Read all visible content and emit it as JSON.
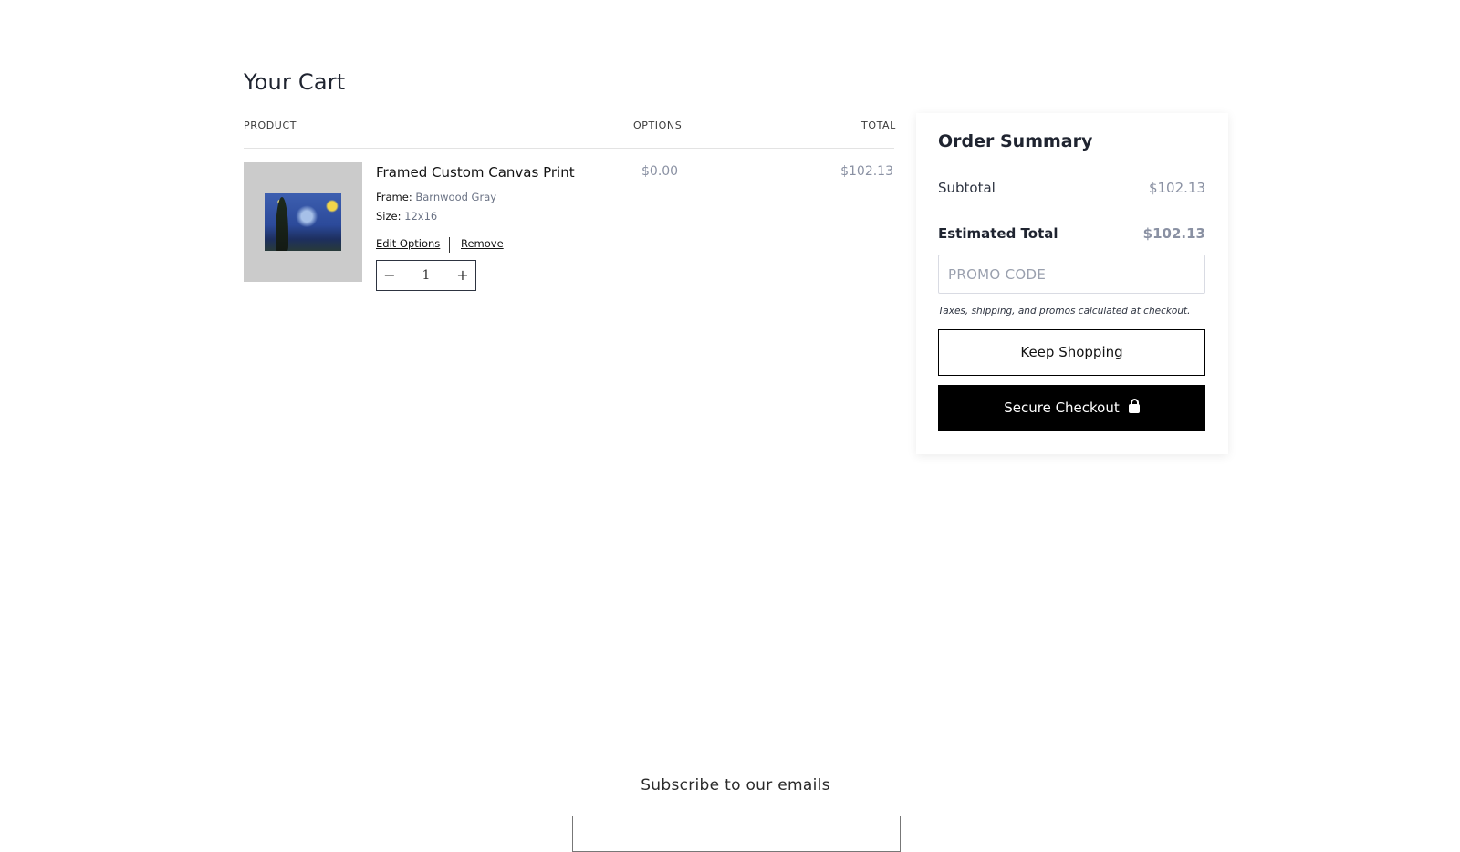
{
  "page": {
    "title": "Your Cart"
  },
  "table": {
    "headers": {
      "product": "PRODUCT",
      "options": "OPTIONS",
      "total": "TOTAL"
    }
  },
  "cart": {
    "items": [
      {
        "name": "Framed Custom Canvas Print",
        "image_alt": "The Starry Night thumbnail",
        "options": [
          {
            "label": "Frame:",
            "value": "Barnwood Gray"
          },
          {
            "label": "Size:",
            "value": "12x16"
          }
        ],
        "edit_label": "Edit Options",
        "remove_label": "Remove",
        "quantity": "1",
        "decrement_symbol": "−",
        "increment_symbol": "+",
        "options_price": "$0.00",
        "total": "$102.13"
      }
    ]
  },
  "summary": {
    "title": "Order Summary",
    "subtotal_label": "Subtotal",
    "subtotal_value": "$102.13",
    "estimated_label": "Estimated Total",
    "estimated_value": "$102.13",
    "promo_placeholder": "PROMO CODE",
    "promo_value": "",
    "note": "Taxes, shipping, and promos calculated at checkout.",
    "keep_shopping": "Keep Shopping",
    "secure_checkout": "Secure Checkout",
    "checkout_icon": "lock-icon"
  },
  "footer": {
    "subscribe_title": "Subscribe to our emails"
  }
}
